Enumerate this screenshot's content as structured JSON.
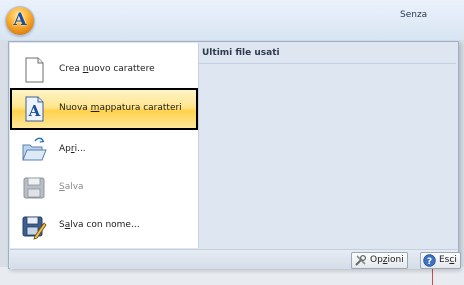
{
  "window": {
    "title": "Senza"
  },
  "menu": {
    "commands": [
      {
        "pre": "Crea ",
        "key": "n",
        "post": "uovo carattere",
        "icon": "new-document-icon",
        "enabled": true,
        "highlighted": false
      },
      {
        "pre": "Nuova ",
        "key": "m",
        "post": "appatura caratteri",
        "icon": "character-mapping-icon",
        "enabled": true,
        "highlighted": true
      },
      {
        "pre": "Ap",
        "key": "r",
        "post": "i...",
        "icon": "open-folder-icon",
        "enabled": true,
        "highlighted": false
      },
      {
        "pre": "",
        "key": "S",
        "post": "alva",
        "icon": "save-icon",
        "enabled": false,
        "highlighted": false
      },
      {
        "pre": "S",
        "key": "a",
        "post": "lva con nome...",
        "icon": "save-as-icon",
        "enabled": true,
        "highlighted": false
      }
    ],
    "recent_header": "Ultimi file usati",
    "options_button": {
      "pre": "Op",
      "key": "z",
      "post": "ioni",
      "icon": "options-icon"
    },
    "exit_button": {
      "pre": "Es",
      "key": "c",
      "post": "i",
      "icon": "help-icon"
    }
  },
  "colors": {
    "highlight": "#ffd24d",
    "panel": "#dde6f1",
    "accent": "#1c4f9c"
  }
}
